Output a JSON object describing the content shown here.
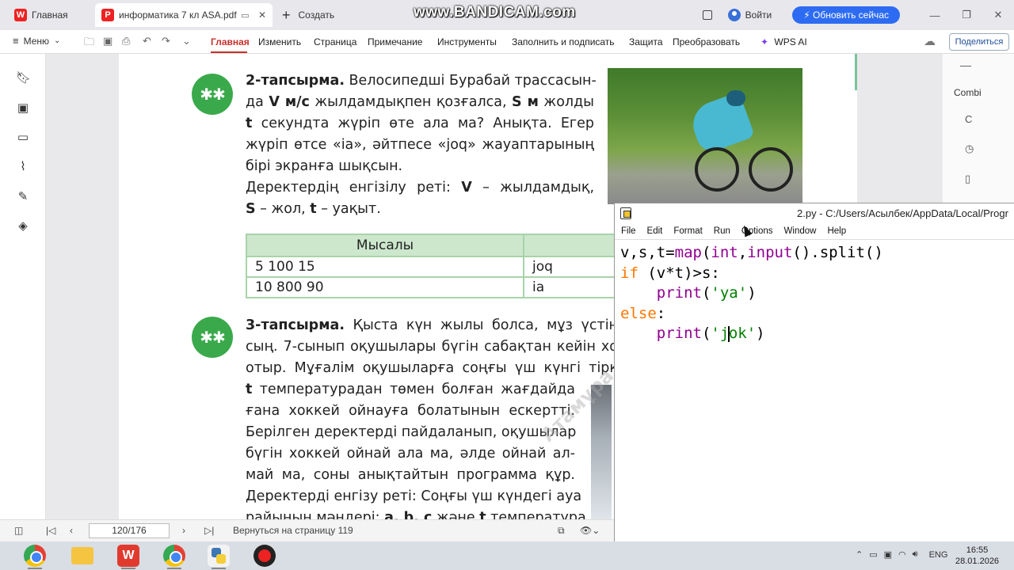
{
  "wps": {
    "tabs": [
      {
        "label": "Главная"
      },
      {
        "label": "информатика 7 кл ASA.pdf"
      }
    ],
    "new_tab_label": "Создать",
    "login_label": "Войти",
    "update_label": "Обновить сейчас",
    "menu_label": "Меню",
    "ribbon_tabs": [
      "Главная",
      "Изменить",
      "Страница",
      "Примечание",
      "Инструменты",
      "Заполнить и подписать",
      "Защита",
      "Преобразовать"
    ],
    "wps_ai_label": "WPS AI",
    "share_label": "Поделиться",
    "right_panel_label": "Combi"
  },
  "watermark_text": "www.BANDICAM.com",
  "document": {
    "task2": {
      "lines": [
        [
          "2-тапсырма.",
          " Велосипедші Бурабай трассасын-"
        ],
        [
          "да ",
          "V м/с",
          " жылдамдықпен қозғалса, ",
          "S м",
          " жолды"
        ],
        [
          "t",
          " секундта жүріп өте ала ма? Анықта. Егер"
        ],
        [
          "жүріп өтсе «ia», әйтпесе «joq» жауаптарының"
        ],
        [
          "бірі экранға шықсын."
        ],
        [
          "Деректердің енгізілу реті: ",
          "V",
          " – жылдамдық,"
        ],
        [
          "S",
          " – жол, ",
          "t",
          " – уақыт."
        ]
      ]
    },
    "example_table": {
      "header": "Мысалы",
      "rows": [
        [
          "5 100 15",
          "joq"
        ],
        [
          "10 800 90",
          "ia"
        ]
      ]
    },
    "task3": {
      "lines": [
        [
          "3-тапсырма.",
          " Қыста күн жылы болса, мұз үстін"
        ],
        [
          "сың. 7-сынып оқушылары бүгін сабақтан кейін хо"
        ],
        [
          "отыр. Мұғалім оқушыларға соңғы үш күнгі тірк"
        ],
        [
          "t",
          " температурадан төмен болған жағдайда"
        ],
        [
          "ғана хоккей ойнауға болатынын ескертті."
        ],
        [
          "Берілген деректерді пайдаланып, оқушылар"
        ],
        [
          "бүгін хоккей ойнай ала ма, әлде ойнай ал-"
        ],
        [
          "май ма, соны анықтайтын программа құр."
        ],
        [
          "Деректерді енгізу реті: Соңғы үш күндегі ауа"
        ],
        [
          "райының мәндері: ",
          "a, b, c",
          " және ",
          "t",
          " температура."
        ]
      ]
    },
    "page_watermark": "Атамұра"
  },
  "statusbar": {
    "page_indicator": "120/176",
    "back_label": "Вернуться на страницу 119"
  },
  "idle": {
    "title": "2.py - C:/Users/Асылбек/AppData/Local/Progr",
    "menu": [
      "File",
      "Edit",
      "Format",
      "Run",
      "Options",
      "Window",
      "Help"
    ],
    "code": {
      "line1": [
        "v,s,t=",
        "map",
        "(",
        "int",
        ",",
        "input",
        "().split()"
      ],
      "line2": [
        "if",
        " (v*t)>s:"
      ],
      "line3": [
        "    ",
        "print",
        "(",
        "'ya'",
        ")"
      ],
      "line4": [
        "else",
        ":"
      ],
      "line5": [
        "    ",
        "print",
        "(",
        "'j",
        "ok'",
        ")"
      ]
    }
  },
  "taskbar": {
    "language": "ENG",
    "time": "16:55",
    "date": "28.01.2026"
  }
}
